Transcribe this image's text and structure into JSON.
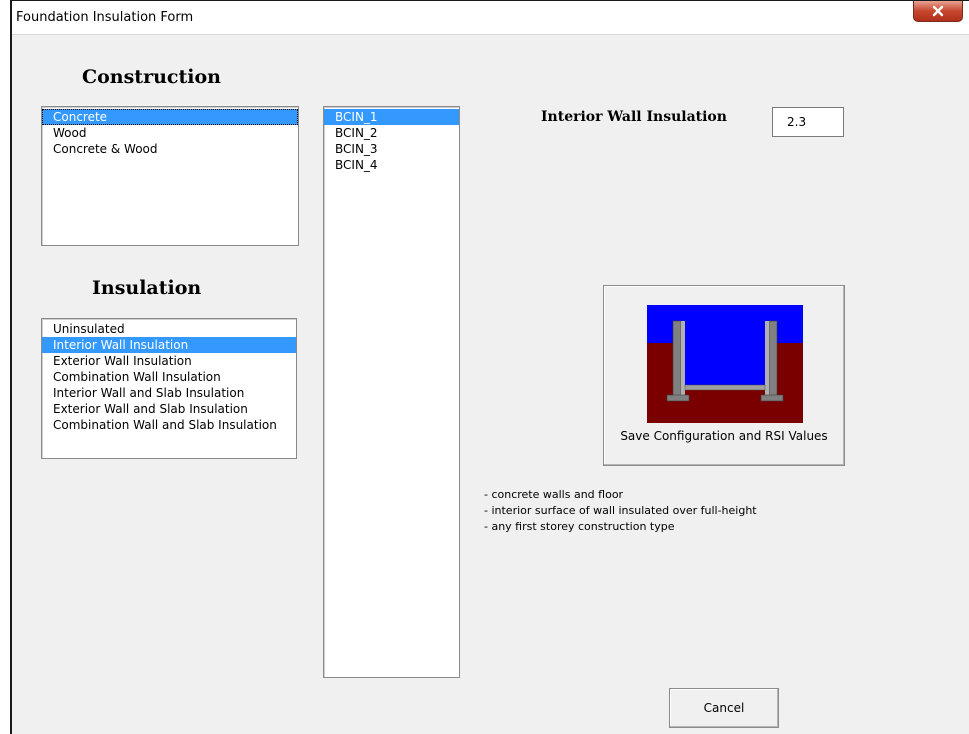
{
  "window": {
    "title": "Foundation Insulation Form"
  },
  "construction": {
    "heading": "Construction",
    "items": [
      "Concrete",
      "Wood",
      "Concrete & Wood"
    ],
    "selected_index": 0
  },
  "insulation": {
    "heading": "Insulation",
    "items": [
      "Uninsulated",
      "Interior Wall Insulation",
      "Exterior Wall Insulation",
      "Combination Wall Insulation",
      "Interior Wall and Slab Insulation",
      "Exterior Wall and Slab Insulation",
      "Combination Wall and Slab Insulation"
    ],
    "selected_index": 1
  },
  "codes": {
    "items": [
      "BCIN_1",
      "BCIN_2",
      "BCIN_3",
      "BCIN_4"
    ],
    "selected_index": 0
  },
  "rsi": {
    "label": "Interior Wall Insulation",
    "value": "2.3"
  },
  "save_button": {
    "label": "Save Configuration and RSI Values",
    "colors": {
      "sky": "#0000ff",
      "ground": "#7a0000",
      "wall": "#808080"
    }
  },
  "description": [
    "- concrete walls and floor",
    "- interior surface of wall insulated over full-height",
    "- any first storey construction type"
  ],
  "cancel_button": {
    "label": "Cancel"
  }
}
